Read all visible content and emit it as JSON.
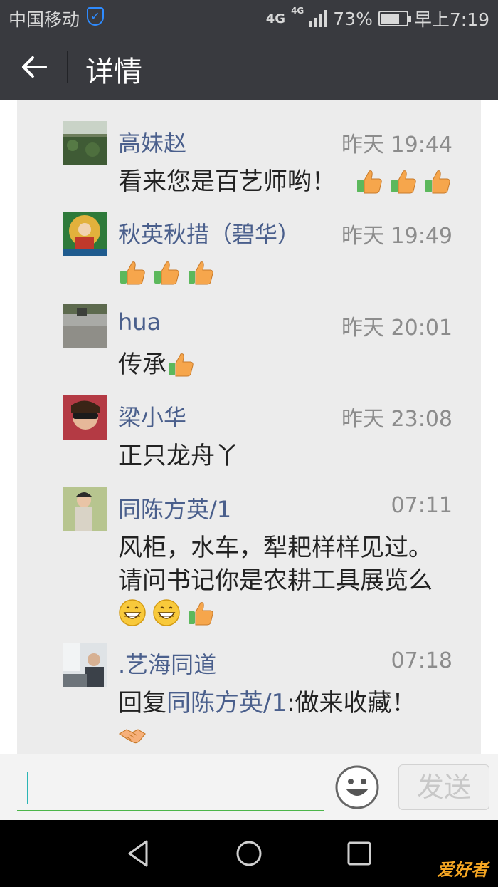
{
  "status_bar": {
    "carrier": "中国移动",
    "network_a": "4G",
    "network_b": "4G",
    "battery": "73%",
    "battery_level": 0.73,
    "time": "早上7:19"
  },
  "title_bar": {
    "title": "详情"
  },
  "comments": [
    {
      "name": "高妹赵",
      "time": "昨天 19:44",
      "text": "看来您是百艺师哟！",
      "emojis": [
        "thumbs-up",
        "thumbs-up",
        "thumbs-up"
      ]
    },
    {
      "name": "秋英秋措（碧华）",
      "time": "昨天 19:49",
      "text": "",
      "emojis": [
        "thumbs-up",
        "thumbs-up",
        "thumbs-up"
      ]
    },
    {
      "name": "hua",
      "time": "昨天 20:01",
      "text": "传承",
      "emojis": [
        "thumbs-up"
      ]
    },
    {
      "name": "梁小华",
      "time": "昨天 23:08",
      "text": "正只龙舟丫"
    },
    {
      "name": "同陈方英/1",
      "time": "07:11",
      "text_line1": "风柜，水车，犁耙样样见过。",
      "text_line2": "请问书记你是农耕工具展览么",
      "emojis": [
        "grin",
        "grin",
        "thumbs-up"
      ]
    },
    {
      "name": ".艺海同道",
      "time": "07:18",
      "reply_prefix": "回复",
      "reply_to": "同陈方英/1",
      "text": ":做来收藏！",
      "emojis": [
        "handshake"
      ]
    }
  ],
  "input_bar": {
    "send_label": "发送"
  },
  "watermark": "爱好者"
}
